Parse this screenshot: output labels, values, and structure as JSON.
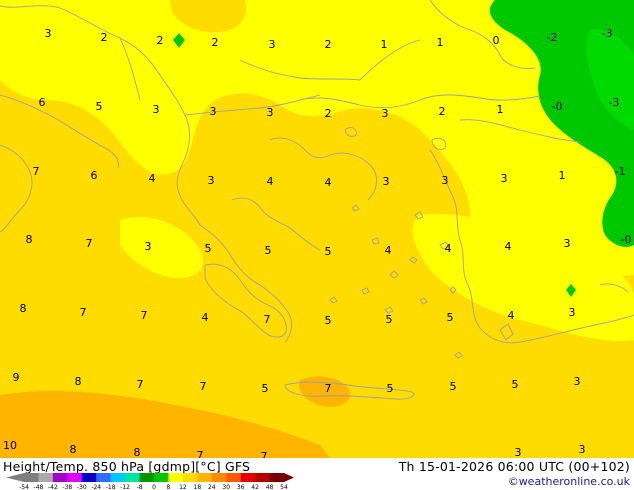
{
  "header": {
    "title": "Height/Temp. 850 hPa [gdmp][°C] GFS",
    "valid_time": "Th 15-01-2026 06:00 UTC (00+102)",
    "credit": "©weatheronline.co.uk"
  },
  "colorbar": {
    "ticks": [
      "-54",
      "-48",
      "-42",
      "-38",
      "-30",
      "-24",
      "-18",
      "-12",
      "-8",
      "0",
      "8",
      "12",
      "18",
      "24",
      "30",
      "36",
      "42",
      "48",
      "54"
    ],
    "colors": [
      "#7f7f7f",
      "#a9a9a9",
      "#a000c8",
      "#e600ff",
      "#0000c8",
      "#2f6bff",
      "#00c8ff",
      "#00e6a0",
      "#009600",
      "#00c800",
      "#ffff00",
      "#ffdc00",
      "#ffb400",
      "#ff8c00",
      "#ff5a00",
      "#e60000",
      "#b40000",
      "#780000"
    ]
  },
  "isotherm_labels": [
    {
      "text": "3"
    },
    {
      "text": "2"
    },
    {
      "text": "2"
    },
    {
      "text": "2"
    },
    {
      "text": "3"
    },
    {
      "text": "2"
    },
    {
      "text": "1"
    },
    {
      "text": "1"
    },
    {
      "text": "0"
    },
    {
      "text": "-2"
    },
    {
      "text": "-3"
    },
    {
      "text": "6"
    },
    {
      "text": "5"
    },
    {
      "text": "3"
    },
    {
      "text": "3"
    },
    {
      "text": "3"
    },
    {
      "text": "2"
    },
    {
      "text": "3"
    },
    {
      "text": "2"
    },
    {
      "text": "1"
    },
    {
      "text": "-0"
    },
    {
      "text": "-3"
    },
    {
      "text": "7"
    },
    {
      "text": "6"
    },
    {
      "text": "4"
    },
    {
      "text": "3"
    },
    {
      "text": "4"
    },
    {
      "text": "4"
    },
    {
      "text": "3"
    },
    {
      "text": "3"
    },
    {
      "text": "3"
    },
    {
      "text": "1"
    },
    {
      "text": "-1"
    },
    {
      "text": "8"
    },
    {
      "text": "7"
    },
    {
      "text": "3"
    },
    {
      "text": "5"
    },
    {
      "text": "5"
    },
    {
      "text": "5"
    },
    {
      "text": "4"
    },
    {
      "text": "4"
    },
    {
      "text": "4"
    },
    {
      "text": "3"
    },
    {
      "text": "-0"
    },
    {
      "text": "8"
    },
    {
      "text": "7"
    },
    {
      "text": "7"
    },
    {
      "text": "4"
    },
    {
      "text": "7"
    },
    {
      "text": "5"
    },
    {
      "text": "5"
    },
    {
      "text": "5"
    },
    {
      "text": "4"
    },
    {
      "text": "3"
    },
    {
      "text": "9"
    },
    {
      "text": "8"
    },
    {
      "text": "7"
    },
    {
      "text": "7"
    },
    {
      "text": "5"
    },
    {
      "text": "7"
    },
    {
      "text": "5"
    },
    {
      "text": "5"
    },
    {
      "text": "5"
    },
    {
      "text": "3"
    },
    {
      "text": "10"
    },
    {
      "text": "8"
    },
    {
      "text": "8"
    },
    {
      "text": "7"
    },
    {
      "text": "7"
    },
    {
      "text": "3"
    },
    {
      "text": "3"
    }
  ],
  "colors": {
    "yellow": "#ffff00",
    "gold": "#ffdc00",
    "orange": "#ffb400",
    "green": "#00c800",
    "bright_green": "#00dc00",
    "coast": "#a0a0a0"
  }
}
